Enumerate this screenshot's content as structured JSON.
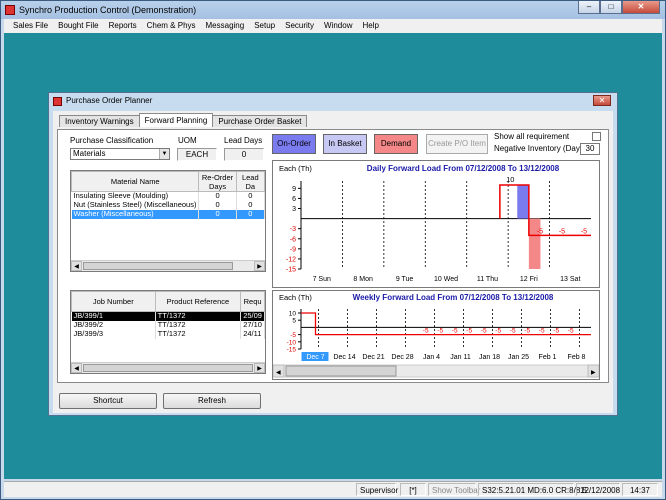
{
  "app": {
    "title": "Synchro Production Control (Demonstration)",
    "menu": [
      "Sales File",
      "Bought File",
      "Reports",
      "Chem & Phys",
      "Messaging",
      "Setup",
      "Security",
      "Window",
      "Help"
    ],
    "window_buttons": {
      "minimize": "–",
      "maximize": "□",
      "close": "✕"
    }
  },
  "status": {
    "user": "Supervisor",
    "flag": "[*]",
    "toolbar": "Show Toolbar",
    "version": "S32:5.21.01 MD:6.0 CR:8/8.5",
    "date": "12/12/2008",
    "time": "14:37"
  },
  "dialog": {
    "title": "Purchase Order Planner",
    "close": "✕",
    "tabs": [
      "Inventory Warnings",
      "Forward Planning",
      "Purchase Order Basket"
    ],
    "active_tab": 1,
    "purchase_classification_label": "Purchase Classification",
    "purchase_classification_value": "Materials",
    "uom_label": "UOM",
    "uom_value": "EACH",
    "lead_days_label": "Lead Days",
    "lead_days_value": "0",
    "buttons": {
      "on_order": "On-Order",
      "in_basket": "In Basket",
      "demand": "Demand",
      "create_po": "Create P/O Item",
      "shortcut": "Shortcut",
      "refresh": "Refresh"
    },
    "colors": {
      "on_order": "#7b7bf0",
      "in_basket": "#c8c8f4",
      "demand": "#f48888"
    },
    "show_all_label": "Show all requirement",
    "negative_inventory_label": "Negative Inventory (Days)",
    "negative_inventory_value": "30",
    "materials_table": {
      "headers": [
        "Material Name",
        "Re-Order Days",
        "Lead Da"
      ],
      "rows": [
        [
          "Insulating Sleeve (Moulding)",
          "0",
          "0"
        ],
        [
          "Nut (Stainless Steel) (Miscellaneous)",
          "0",
          "0"
        ],
        [
          "Washer (Miscellaneous)",
          "0",
          "0"
        ]
      ],
      "selected": 2
    },
    "jobs_table": {
      "headers": [
        "Job Number",
        "Product Reference",
        "Requ"
      ],
      "rows": [
        [
          "JB/399/1",
          "TT/1372",
          "25/09"
        ],
        [
          "JB/399/2",
          "TT/1372",
          "27/10"
        ],
        [
          "JB/399/3",
          "TT/1372",
          "24/11"
        ]
      ],
      "selected": 0
    }
  },
  "chart_data": [
    {
      "type": "bar",
      "title": "Daily Forward Load From 07/12/2008 To 13/12/2008",
      "ylabel": "Each (Th)",
      "categories": [
        "7 Sun",
        "8 Mon",
        "9 Tue",
        "10 Wed",
        "11 Thu",
        "12 Fri",
        "13 Sat"
      ],
      "yticks": [
        "9",
        "6",
        "3",
        "-3",
        "-6",
        "-9",
        "-12",
        "-15"
      ],
      "ylim": [
        -15,
        10
      ],
      "series": [
        {
          "name": "On-Order",
          "values": [
            0,
            0,
            0,
            0,
            0,
            10,
            0
          ]
        },
        {
          "name": "Demand",
          "values": [
            0,
            0,
            0,
            0,
            0,
            -15,
            0
          ]
        }
      ],
      "inventory_line": [
        0,
        0,
        0,
        0,
        0,
        10,
        -5,
        -5,
        -5
      ],
      "annotations": [
        "10",
        "-5",
        "-5",
        "-5"
      ]
    },
    {
      "type": "line",
      "title": "Weekly Forward Load From 07/12/2008 To 13/12/2008",
      "ylabel": "Each (Th)",
      "categories": [
        "Dec 7",
        "Dec 14",
        "Dec 21",
        "Dec 28",
        "Jan 4",
        "Jan 11",
        "Jan 18",
        "Jan 25",
        "Feb 1",
        "Feb 8"
      ],
      "selected_category": "Dec 7",
      "yticks": [
        "10",
        "5",
        "-5",
        "-10",
        "-15"
      ],
      "ylim": [
        -15,
        10
      ],
      "inventory_values": [
        -5,
        -5,
        -5,
        -5,
        -5,
        -5,
        -5,
        -5,
        -5,
        -5,
        -5
      ],
      "annotations": [
        "-5",
        "-5",
        "-5",
        "-5",
        "-5",
        "-5",
        "-5",
        "-5",
        "-5",
        "-5",
        "-5"
      ]
    }
  ]
}
